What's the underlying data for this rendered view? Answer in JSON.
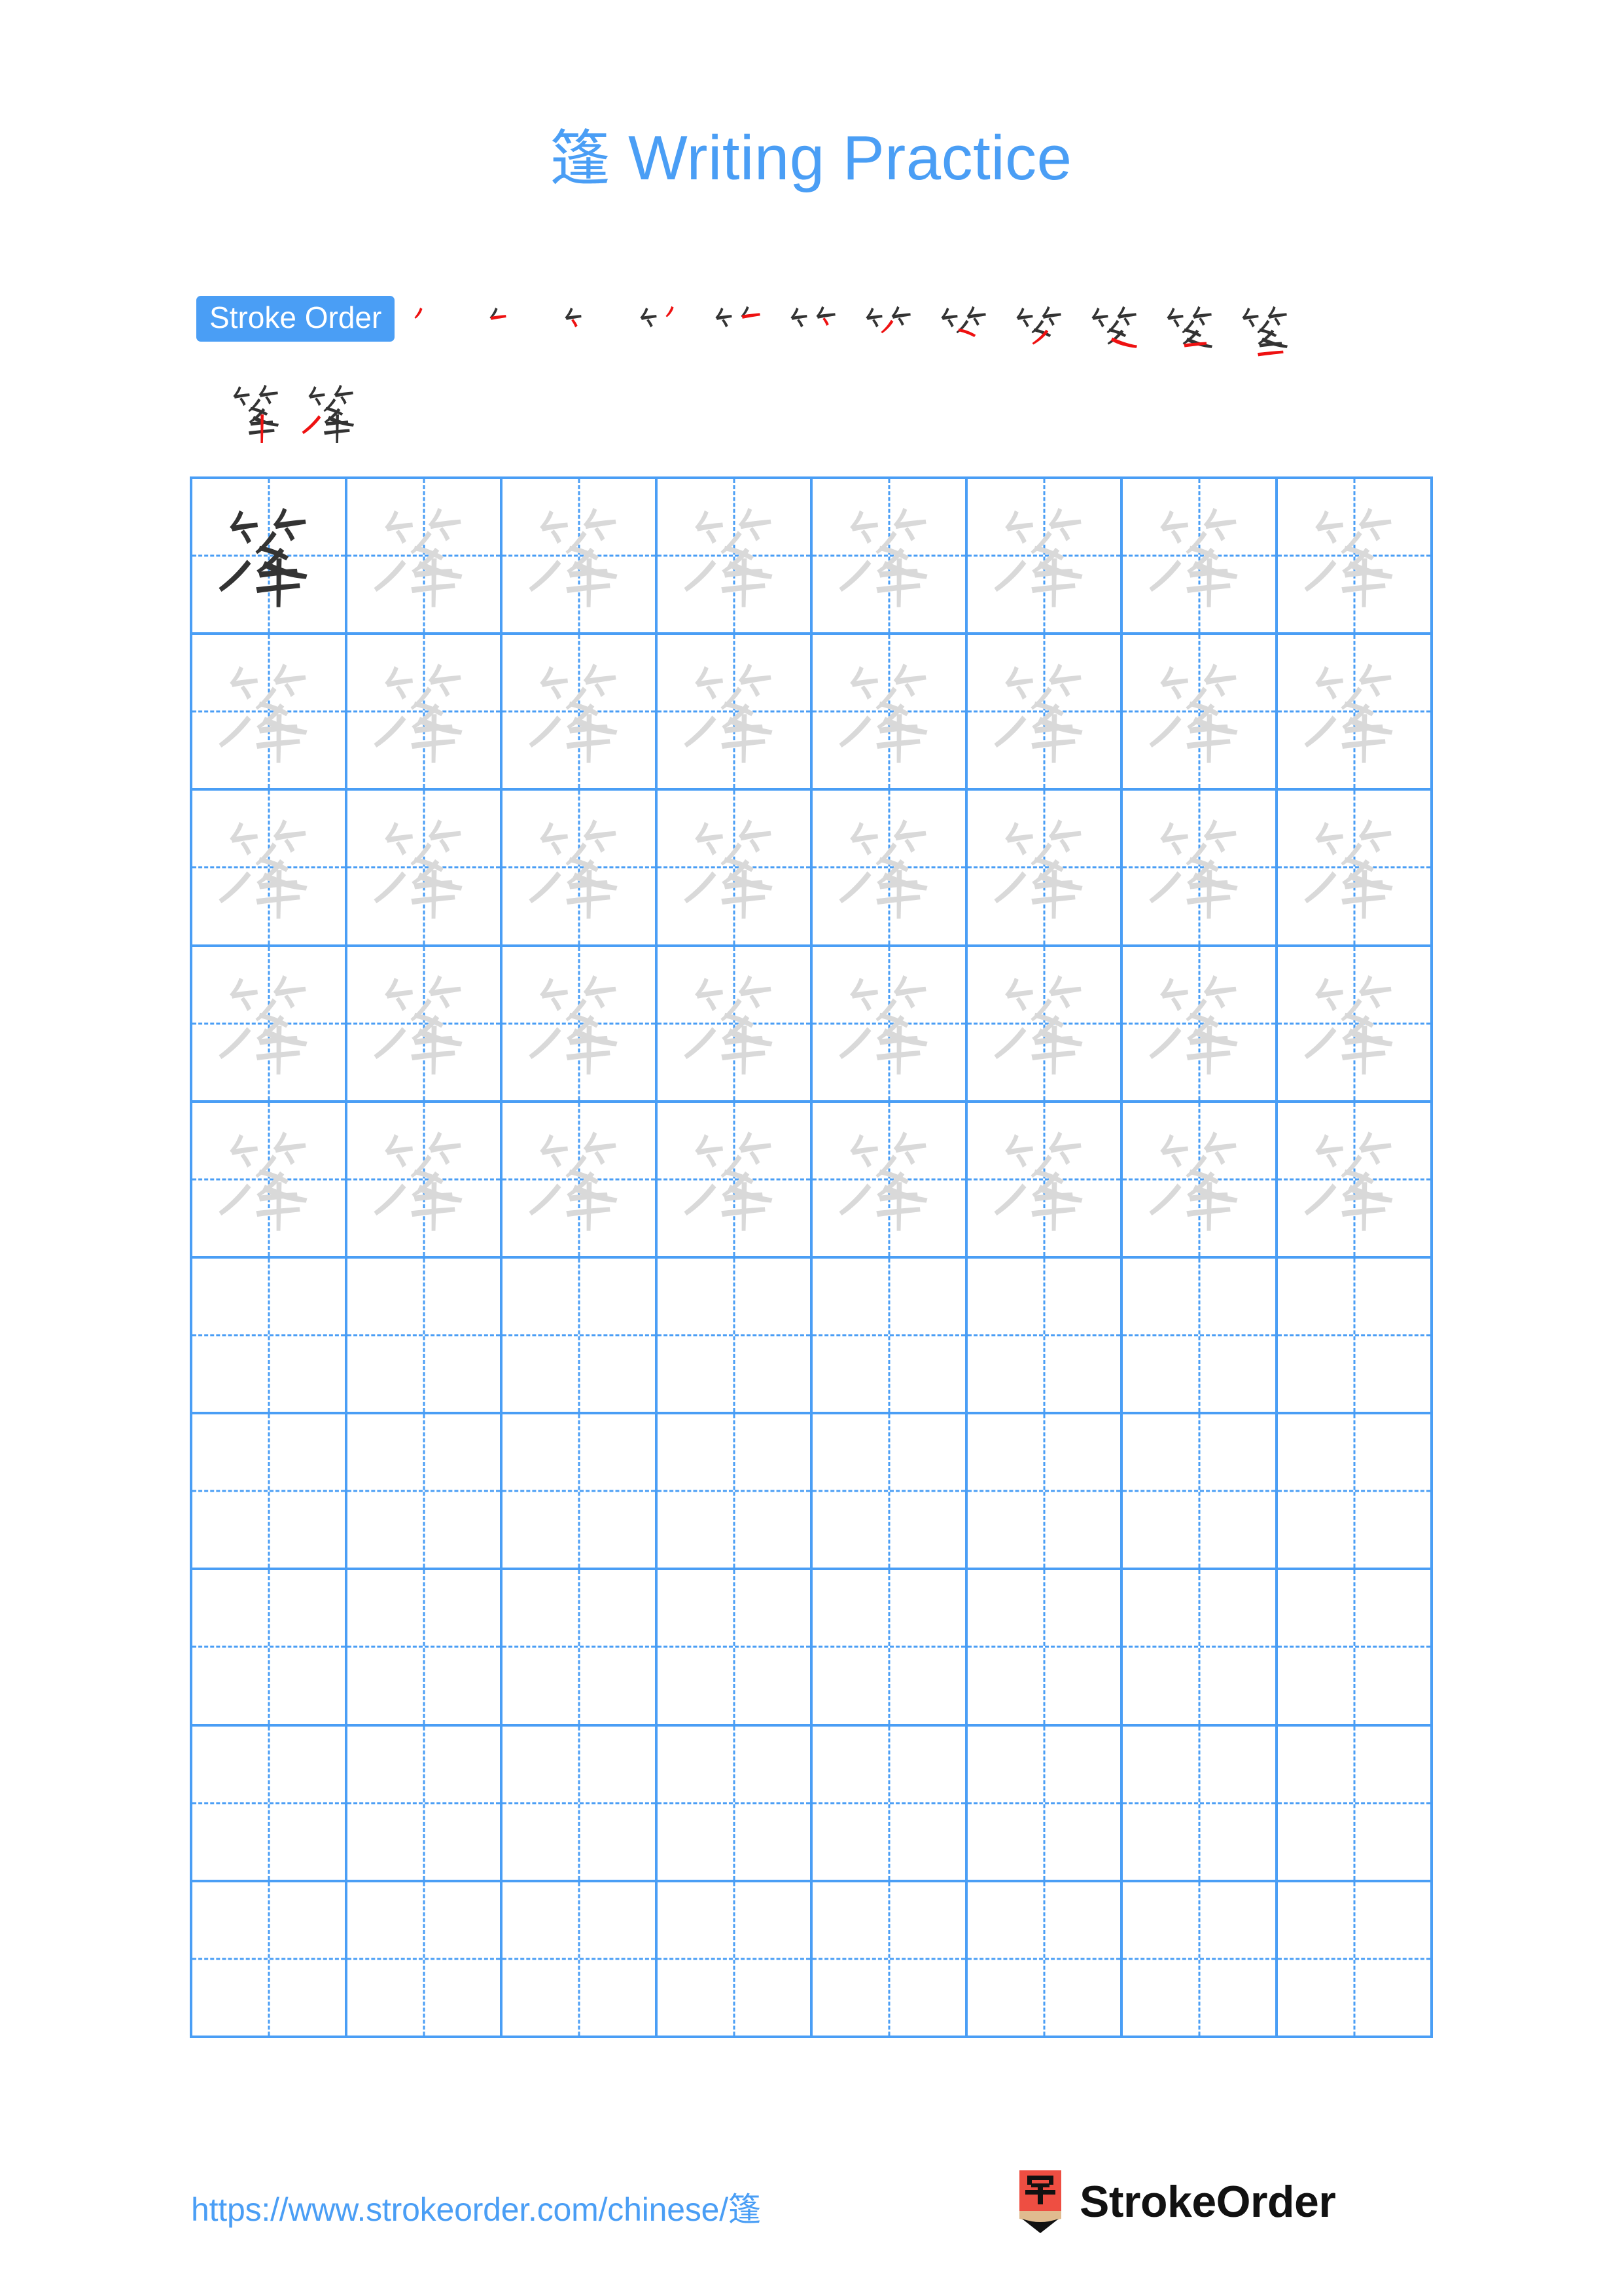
{
  "character": "篷",
  "header": {
    "title_character": "篷",
    "title_text": " Writing Practice"
  },
  "stroke_order": {
    "badge_label": "Stroke Order",
    "total_strokes": 14,
    "steps_row1_count": 12,
    "steps_row2_count": 2,
    "new_stroke_color": "#ee1111",
    "prior_stroke_color": "#333333",
    "step_labels": [
      "stroke-1",
      "stroke-2",
      "stroke-3",
      "stroke-4",
      "stroke-5",
      "stroke-6",
      "stroke-7",
      "stroke-8",
      "stroke-9",
      "stroke-10",
      "stroke-11",
      "stroke-12",
      "stroke-13",
      "stroke-14"
    ]
  },
  "grid": {
    "columns": 8,
    "rows": 10,
    "filled_rows": 5,
    "model_cell_index": 0,
    "model_glyph_color": "#333333",
    "trace_glyph_color": "#d9d9d9",
    "line_color": "#4a9ef5",
    "total_cells": 80
  },
  "footer": {
    "url_text": "https://www.strokeorder.com/chinese/",
    "url_character": "篷",
    "brand_name": "StrokeOrder",
    "brand_logo_character": "字",
    "brand_logo_color": "#ee4e42"
  },
  "colors": {
    "accent_blue": "#4a9ef5",
    "title_blue": "#42a0f5",
    "ink_black": "#333333",
    "trace_gray": "#d9d9d9",
    "stroke_red": "#ee1111",
    "background": "#ffffff"
  }
}
